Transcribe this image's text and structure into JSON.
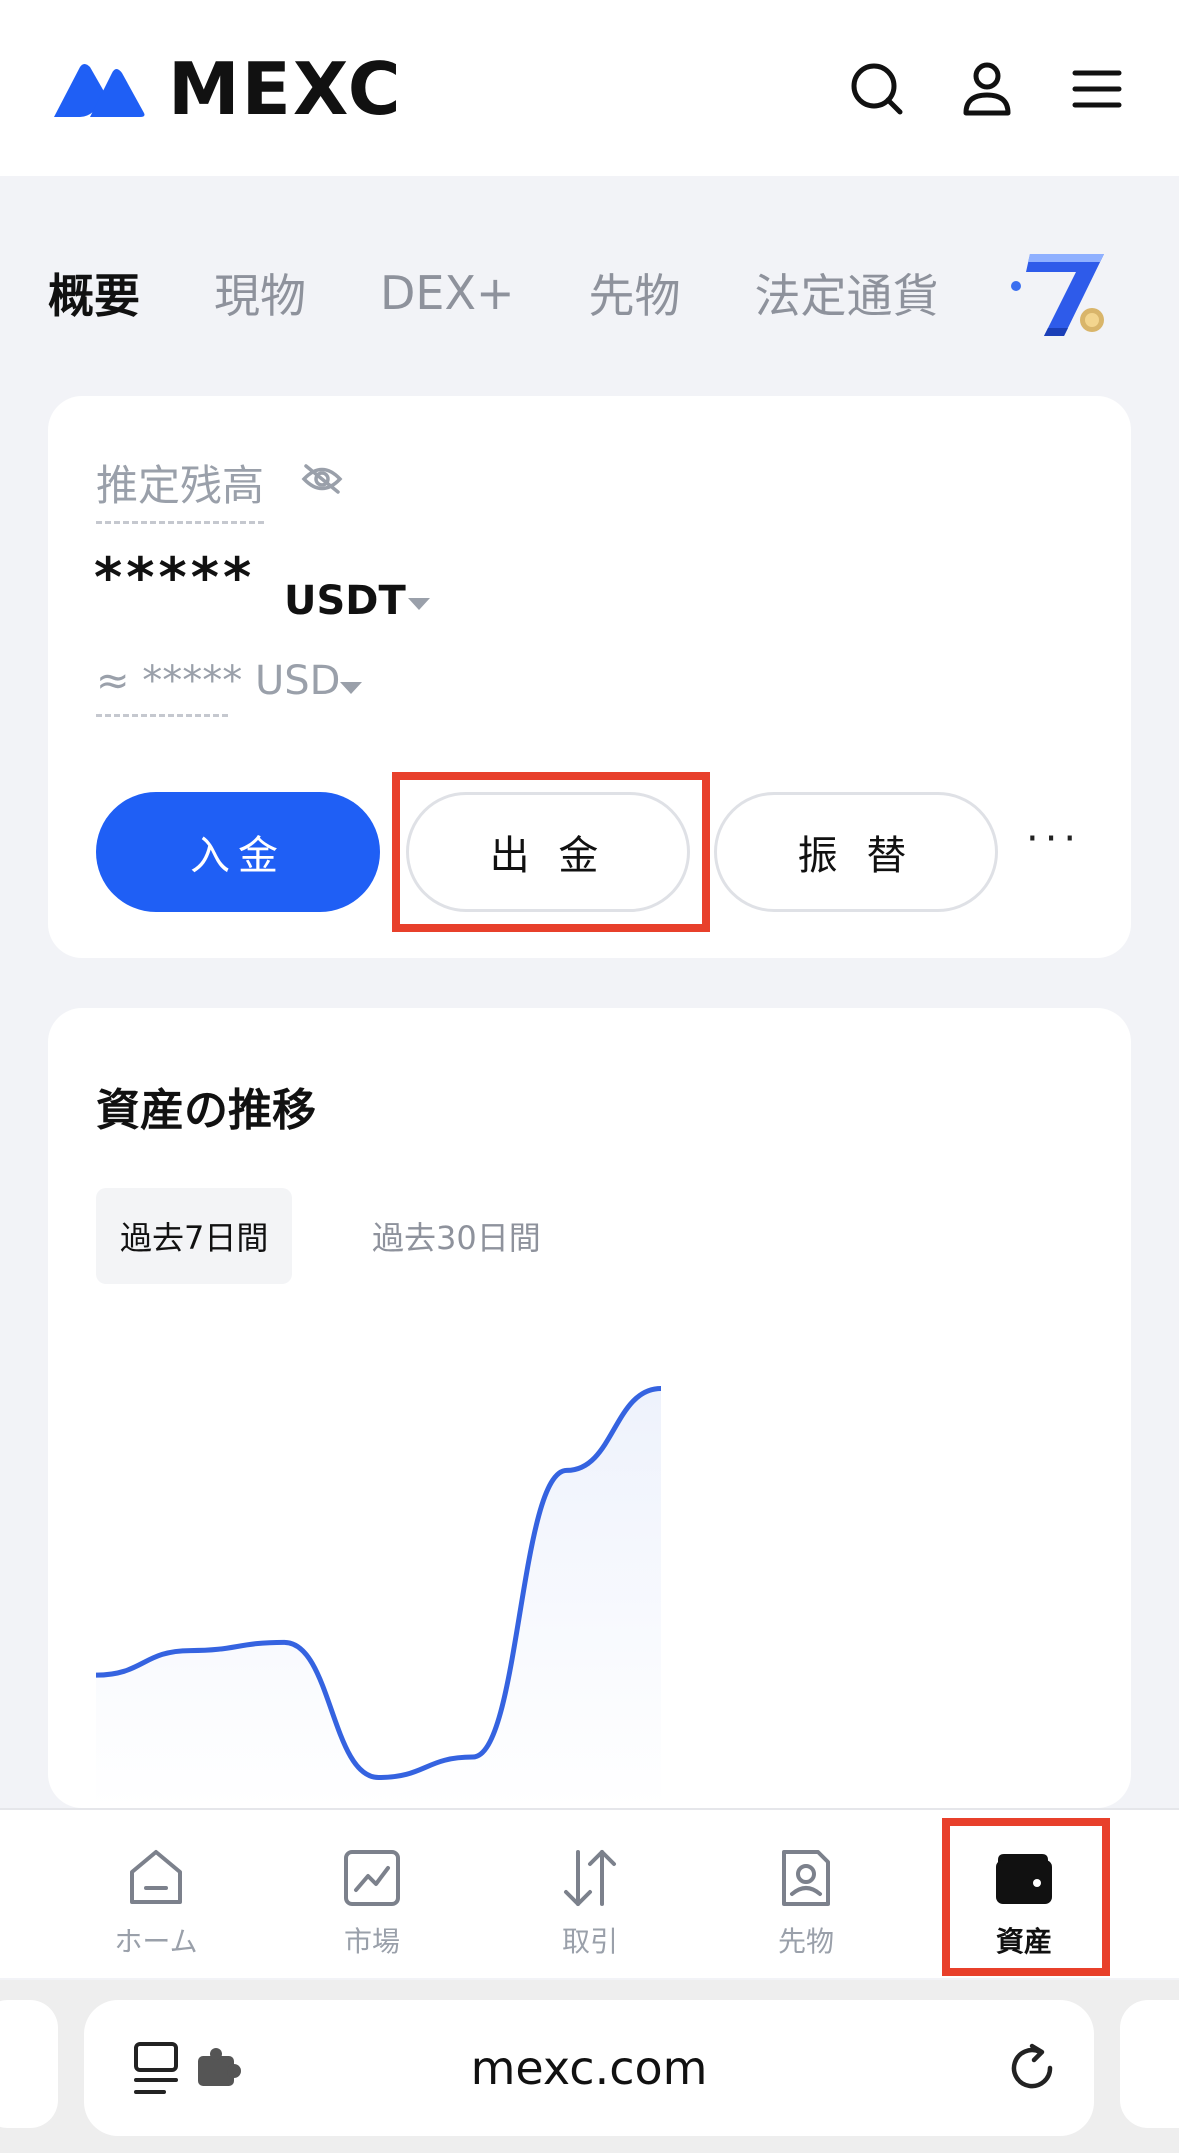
{
  "header": {
    "logo_text": "MEXC",
    "brand_color": "#1f5ff5",
    "icons": [
      "search-icon",
      "user-icon",
      "menu-icon"
    ]
  },
  "tabs": [
    {
      "label": "概要",
      "active": true
    },
    {
      "label": "現物",
      "active": false
    },
    {
      "label": "DEX+",
      "active": false
    },
    {
      "label": "先物",
      "active": false
    },
    {
      "label": "法定通貨",
      "active": false
    }
  ],
  "balance": {
    "label": "推定残高",
    "masked_value": "*****",
    "unit": "USDT",
    "approx_prefix": "≈",
    "approx_masked": "*****",
    "approx_unit": "USD"
  },
  "actions": {
    "deposit": "入金",
    "withdraw": "出 金",
    "transfer": "振 替",
    "more": "···"
  },
  "asset_trend": {
    "title": "資産の推移",
    "ranges": [
      {
        "label": "過去7日間",
        "active": true
      },
      {
        "label": "過去30日間",
        "active": false
      }
    ],
    "line_color": "#3563e0"
  },
  "chart_data": {
    "type": "line",
    "x": [
      1,
      2,
      3,
      4,
      5,
      6,
      7
    ],
    "series": [
      {
        "values": [
          0.3,
          0.36,
          0.38,
          0.05,
          0.1,
          0.8,
          1.0
        ]
      }
    ],
    "ylim": [
      0,
      1.05
    ],
    "grid": false
  },
  "bottom_nav": [
    {
      "label": "ホーム",
      "icon": "home-icon",
      "active": false
    },
    {
      "label": "市場",
      "icon": "market-chart-icon",
      "active": false
    },
    {
      "label": "取引",
      "icon": "trade-arrows-icon",
      "active": false
    },
    {
      "label": "先物",
      "icon": "futures-icon",
      "active": false
    },
    {
      "label": "資産",
      "icon": "wallet-icon",
      "active": true
    }
  ],
  "browser": {
    "url": "mexc.com"
  },
  "annotations": {
    "highlight_color": "#e8402b"
  }
}
